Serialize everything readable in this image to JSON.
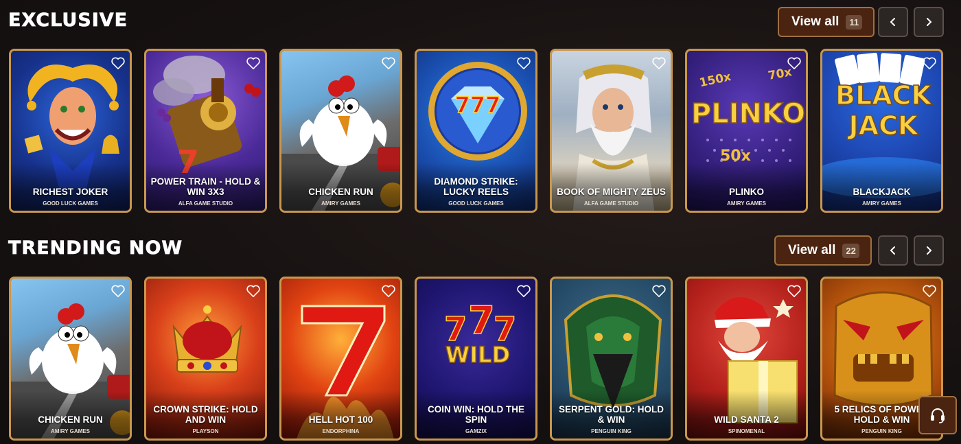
{
  "sections": {
    "exclusive": {
      "title": "EXCLUSIVE",
      "view_all_label": "View all",
      "view_all_count": "11",
      "games": [
        {
          "name": "RICHEST JOKER",
          "studio": "GOOD LUCK GAMES"
        },
        {
          "name": "POWER TRAIN - HOLD & WIN 3X3",
          "studio": "ALFA GAME STUDIO"
        },
        {
          "name": "CHICKEN RUN",
          "studio": "AMIRY GAMES"
        },
        {
          "name": "DIAMOND STRIKE: LUCKY REELS",
          "studio": "GOOD LUCK GAMES"
        },
        {
          "name": "BOOK OF MIGHTY ZEUS",
          "studio": "ALFA GAME STUDIO"
        },
        {
          "name": "PLINKO",
          "studio": "AMIRY GAMES"
        },
        {
          "name": "BLACKJACK",
          "studio": "AMIRY GAMES"
        }
      ]
    },
    "trending": {
      "title": "TRENDING NOW",
      "view_all_label": "View all",
      "view_all_count": "22",
      "games": [
        {
          "name": "CHICKEN RUN",
          "studio": "AMIRY GAMES"
        },
        {
          "name": "CROWN STRIKE: HOLD AND WIN",
          "studio": "PLAYSON"
        },
        {
          "name": "HELL HOT 100",
          "studio": "ENDORPHINA"
        },
        {
          "name": "COIN WIN: HOLD THE SPIN",
          "studio": "GAMZIX"
        },
        {
          "name": "SERPENT GOLD: HOLD & WIN",
          "studio": "PENGUIN KING"
        },
        {
          "name": "WILD SANTA 2",
          "studio": "SPINOMENAL"
        },
        {
          "name": "5 RELICS OF POWER HOLD & WIN",
          "studio": "PENGUIN KING"
        }
      ]
    }
  },
  "artwork_text": {
    "plinko_logo": "PLINKO",
    "plinko_multipliers": [
      "150x",
      "70x",
      "50x"
    ],
    "blackjack_logo_line1": "BLACK",
    "blackjack_logo_line2": "JACK",
    "diamond_sevens": "777",
    "coin_wild": "WILD"
  },
  "colors": {
    "accent_button": "#4a2411",
    "accent_border": "#a0703f",
    "card_border": "#c9974d"
  },
  "icons": {
    "favorite": "heart-outline-icon",
    "prev": "chevron-left-icon",
    "next": "chevron-right-icon",
    "support": "headset-icon"
  }
}
